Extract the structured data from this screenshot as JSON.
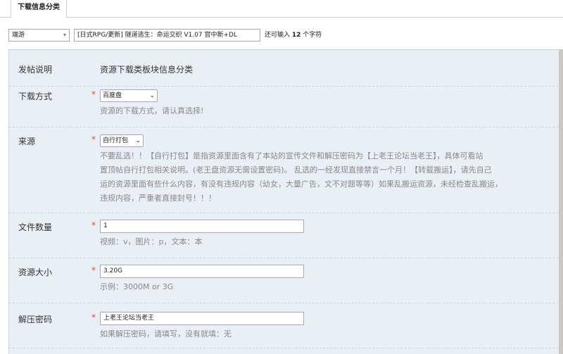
{
  "tab": {
    "label": "下载信息分类"
  },
  "title_row": {
    "category": "端游",
    "title_value": "[日式RPG/更新] 隧道逃生：命运交织  V1.07 官中新+DL",
    "char_hint_prefix": "还可输入",
    "char_hint_count": "12",
    "char_hint_suffix": "个字符"
  },
  "form": {
    "notice": {
      "label": "发帖说明",
      "value": "资源下载类板块信息分类"
    },
    "download_method": {
      "label": "下载方式",
      "required": "*",
      "selected": "百度盘",
      "desc": "资源的下载方式，请认真选择!"
    },
    "source": {
      "label": "来源",
      "required": "*",
      "selected": "自行打包",
      "desc_lines": [
        "不要乱选！！【自行打包】是指资源里面含有了本站的宣传文件和解压密码为【上老王论坛当老王】，具体可看站",
        "置顶帖自行打包相关说明。(老王盘资源无需设置密码)。 乱选的一经发现直接禁言一个月！【转载搬运】，请先自己",
        "运的资源里面有些什么内容，有没有违规内容（幼女，大量广告，文不对题等等）如果乱搬运资源，未经检查乱搬运，",
        "违规内容，严重者直接封号！！！"
      ]
    },
    "file_count": {
      "label": "文件数量",
      "required": "*",
      "value": "1",
      "desc": "视频：v，图片：p，文本：本"
    },
    "size": {
      "label": "资源大小",
      "required": "*",
      "value": "3.20G",
      "desc": "示例：3000M or 3G"
    },
    "password": {
      "label": "解压密码",
      "required": "*",
      "value": "上老王论坛当老王",
      "desc": "如果解压密码，请填写，没有就填：无"
    }
  }
}
